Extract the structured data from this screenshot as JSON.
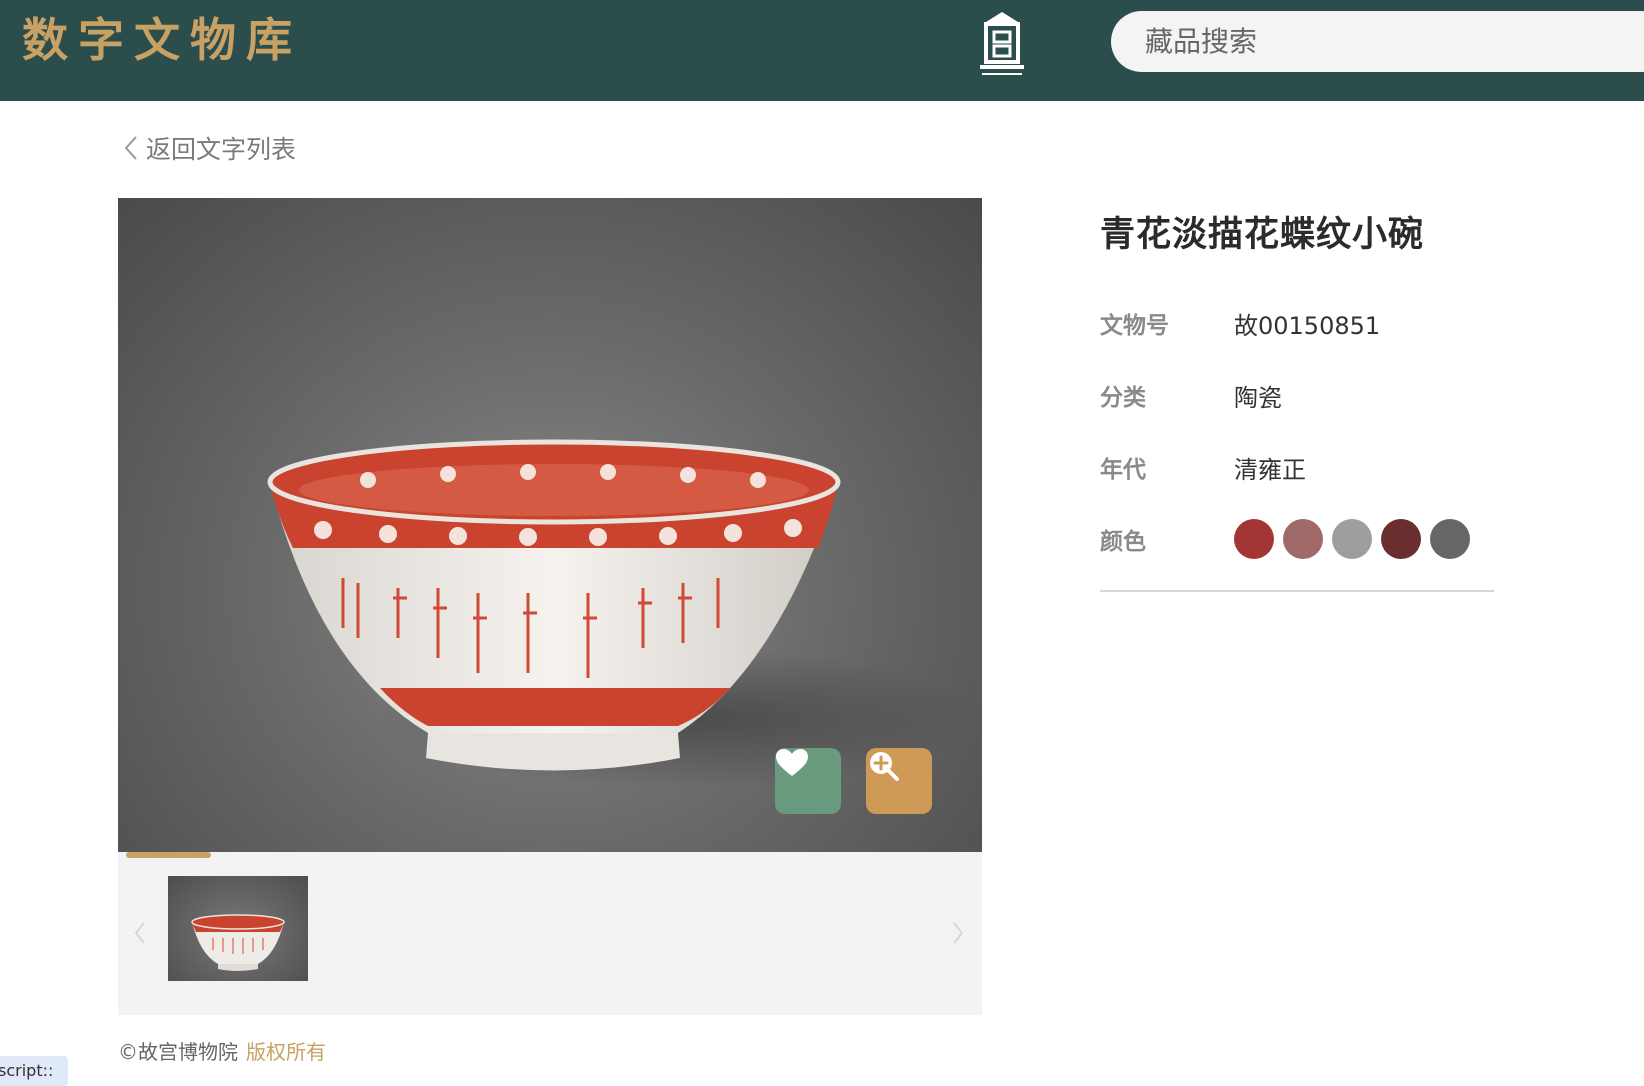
{
  "header": {
    "brand": "数字文物库",
    "museum_logo": "故宫博物院",
    "search_placeholder": "藏品搜索",
    "background": "#2b4e4c"
  },
  "back_link": {
    "label": "返回文字列表"
  },
  "image_viewer": {
    "fav_icon": "heart-icon",
    "zoom_icon": "zoom-in-icon",
    "progress_fraction": 0.1
  },
  "artifact": {
    "title": "青花淡描花蝶纹小碗",
    "details": [
      {
        "label": "文物号",
        "value": "故00150851"
      },
      {
        "label": "分类",
        "value": "陶瓷"
      },
      {
        "label": "年代",
        "value": "清雍正"
      }
    ],
    "color_label": "颜色",
    "colors": [
      "#a33535",
      "#a06a6a",
      "#9e9e9e",
      "#6b2e2e",
      "#666666"
    ]
  },
  "footer": {
    "copyright": "©故宫博物院",
    "rights": "版权所有"
  },
  "devtools": {
    "script_tab": "script::"
  }
}
